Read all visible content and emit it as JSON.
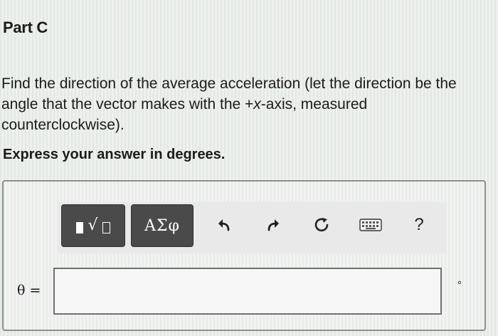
{
  "part": {
    "title": "Part C"
  },
  "question": {
    "text_before": "Find the direction of the average acceleration (let the direction be the angle that the vector makes with the +",
    "axis": "x",
    "text_after": "-axis, measured counterclockwise).",
    "instruction": "Express your answer in degrees."
  },
  "toolbar": {
    "symbols_label": "ΑΣφ",
    "help_label": "?",
    "icons": [
      "templates-icon",
      "undo-icon",
      "redo-icon",
      "reset-icon",
      "keyboard-icon",
      "help-icon"
    ]
  },
  "answer": {
    "variable_label": "θ =",
    "value": "",
    "unit": "°"
  },
  "colors": {
    "button_bg": "#4a4a4a",
    "panel_border": "#8c8f8c"
  }
}
